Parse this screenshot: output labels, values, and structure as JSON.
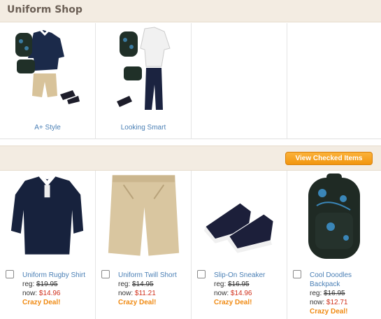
{
  "header": {
    "title": "Uniform Shop"
  },
  "outfits": [
    {
      "label": "A+ Style"
    },
    {
      "label": "Looking Smart"
    },
    {
      "label": ""
    },
    {
      "label": ""
    }
  ],
  "toolbar": {
    "view_checked_label": "View Checked Items"
  },
  "products": [
    {
      "name": "Uniform Rugby Shirt",
      "reg_label": "reg:",
      "reg_price": "$19.95",
      "now_label": "now:",
      "now_price": "$14.96",
      "deal": "Crazy Deal!"
    },
    {
      "name": "Uniform Twill Short",
      "reg_label": "reg:",
      "reg_price": "$14.95",
      "now_label": "now:",
      "now_price": "$11.21",
      "deal": "Crazy Deal!"
    },
    {
      "name": "Slip-On Sneaker",
      "reg_label": "reg:",
      "reg_price": "$16.95",
      "now_label": "now:",
      "now_price": "$14.96",
      "deal": "Crazy Deal!"
    },
    {
      "name": "Cool Doodles Backpack",
      "reg_label": "reg:",
      "reg_price": "$16.95",
      "now_label": "now:",
      "now_price": "$12.71",
      "deal": "Crazy Deal!"
    }
  ],
  "colors": {
    "link": "#4a7fb5",
    "sale_price": "#d0301c",
    "deal": "#f08a12",
    "button": "#f2960f"
  }
}
